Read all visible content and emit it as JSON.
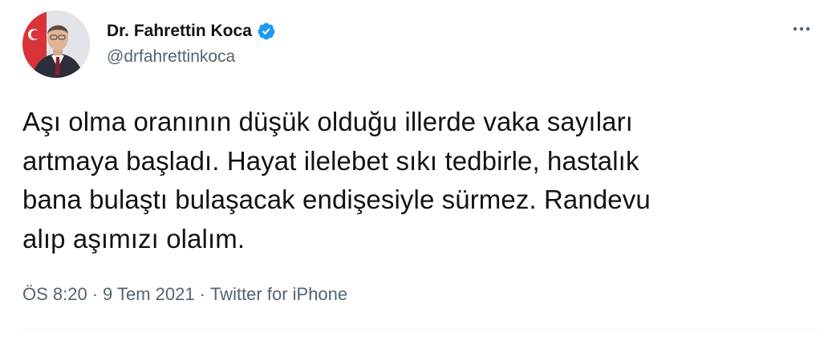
{
  "author": {
    "display_name": "Dr. Fahrettin Koca",
    "handle": "@drfahrettinkoca",
    "verified": true,
    "verified_color": "#1d9bf0"
  },
  "icons": {
    "verified": "verified-badge-icon",
    "more": "more-horizontal-icon"
  },
  "tweet": {
    "text": "Aşı olma oranının düşük olduğu illerde vaka sayıları\nartmaya başladı. Hayat ilelebet sıkı tedbirle, hastalık\nbana bulaştı bulaşacak endişesiyle sürmez. Randevu\nalıp aşımızı olalım.",
    "time": "ÖS 8:20",
    "date": "9 Tem 2021",
    "source": "Twitter for iPhone",
    "separator": "·"
  },
  "colors": {
    "text": "#0f1419",
    "secondary": "#536471",
    "divider": "#eff3f4"
  }
}
